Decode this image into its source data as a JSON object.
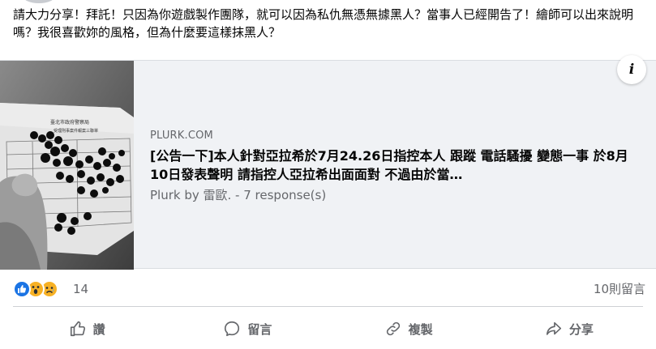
{
  "post": {
    "text": "請大力分享！拜託！只因為你遊戲製作團隊，就可以因為私仇無憑無據黑人？當事人已經開告了！繪師可以出來說明嗎？我很喜歡妳的風格，但為什麼要這樣抹黑人？"
  },
  "link_preview": {
    "domain": "PLURK.COM",
    "title": "[公告一下]本人針對亞拉希於7月24.26日指控本人 跟蹤 電話騷擾 變態一事 於8月10日發表聲明 請指控人亞拉希出面面對 不過由於當…",
    "description": "Plurk by 雷歐. - 7 response(s)",
    "info_icon": "i",
    "thumbnail_header": "臺北市政府警察局",
    "thumbnail_subheader": "受理刑事案件報案三聯單"
  },
  "reactions": {
    "count": "14",
    "types": [
      "like-icon",
      "wow-icon",
      "sad-icon"
    ]
  },
  "comments": {
    "count_label": "10則留言"
  },
  "actions": {
    "like_label": "讚",
    "comment_label": "留言",
    "copy_label": "複製",
    "share_label": "分享"
  },
  "colors": {
    "like_blue": "#1b74e4",
    "emoji_yellow": "#f7b125",
    "secondary_text": "#65676b",
    "card_background": "#f0f2f5"
  }
}
